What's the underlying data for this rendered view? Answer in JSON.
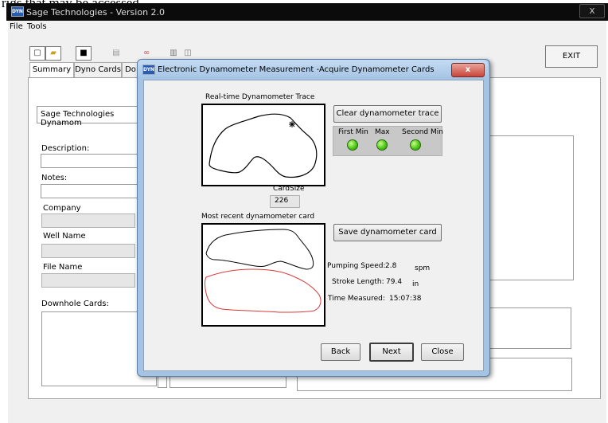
{
  "caption": "rigs that may be accessed.",
  "main_window": {
    "title": "Sage Technologies - Version 2.0",
    "close_label": "x",
    "menu": [
      "File",
      "Tools"
    ],
    "exit_label": "EXIT",
    "tabs": [
      "Summary",
      "Dyno Cards",
      "Do"
    ],
    "summary": {
      "header_value": "Sage Technologies Dynamom",
      "description_label": "Description:",
      "notes_label": "Notes:",
      "company_label": "Company",
      "well_name_label": "Well Name",
      "file_name_label": "File Name",
      "downhole_label": "Downhole Cards:"
    },
    "toolbar_icons": [
      "new-icon",
      "open-icon",
      "dyno-icon",
      "settings-icon",
      "analyze-icon",
      "print-icon",
      "print-preview-icon"
    ]
  },
  "dialog": {
    "title": "Electronic Dynamometer Measurement -Acquire Dynamometer Cards",
    "close_label": "x",
    "realtime_label": "Real-time Dynamometer Trace",
    "clear_button": "Clear dynamometer trace",
    "indicators": [
      "First Min",
      "Max",
      "Second Min"
    ],
    "cardsize_label": "CardSize",
    "cardsize_value": "226",
    "recent_label": "Most recent dynamometer card",
    "save_button": "Save dynamometer card",
    "pumping_speed_label": "Pumping Speed:",
    "pumping_speed_value": "2.8",
    "pumping_speed_unit": "spm",
    "stroke_length_label": "Stroke Length:",
    "stroke_length_value": "79.4",
    "stroke_length_unit": "in",
    "time_measured_label": "Time Measured:",
    "time_measured_value": "15:07:38",
    "buttons": {
      "back": "Back",
      "next": "Next",
      "close": "Close"
    }
  },
  "colors": {
    "surface_trace": "#000000",
    "downhole_trace": "#d83a3a",
    "led_green": "#4fc81a",
    "dialog_frame": "#a5c3e3"
  }
}
